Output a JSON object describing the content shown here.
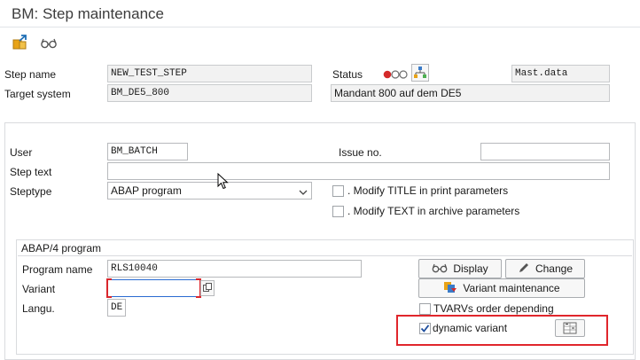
{
  "window": {
    "title": "BM: Step maintenance"
  },
  "toolbar": {
    "icons": [
      "transport-icon",
      "glasses-icon"
    ]
  },
  "header": {
    "step_name_label": "Step name",
    "step_name_value": "NEW_TEST_STEP",
    "target_system_label": "Target system",
    "target_system_value": "BM_DE5_800",
    "status_label": "Status",
    "status_value": "Mast.data",
    "target_system_desc": "Mandant 800 auf dem DE5"
  },
  "form": {
    "user_label": "User",
    "user_value": "BM_BATCH",
    "issue_label": "Issue no.",
    "issue_value": "",
    "step_text_label": "Step text",
    "step_text_value": "",
    "steptype_label": "Steptype",
    "steptype_value": "ABAP program",
    "modify_title_label": ". Modify TITLE in print parameters",
    "modify_text_label": ". Modify TEXT in archive parameters"
  },
  "abap_section": {
    "title": "ABAP/4 program",
    "program_name_label": "Program name",
    "program_name_value": "RLS10040",
    "variant_label": "Variant",
    "variant_value": "",
    "langu_label": "Langu.",
    "langu_value": "DE",
    "display_button": "Display",
    "change_button": "Change",
    "variant_maint_button": "Variant maintenance",
    "tvarv_label": "TVARVs order depending",
    "dynamic_variant_label": "dynamic variant",
    "dynamic_variant_checked": true
  },
  "colors": {
    "status_red": "#d42a2a",
    "highlight_red": "#e0262c"
  }
}
